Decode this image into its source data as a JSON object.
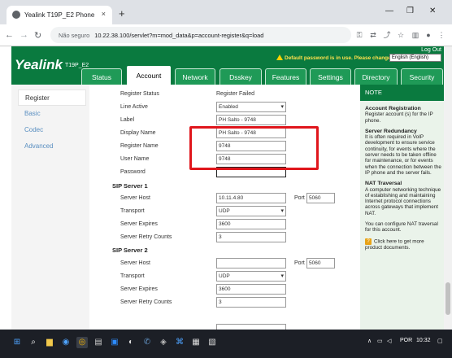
{
  "browser": {
    "tab_title": "Yealink T19P_E2 Phone",
    "new_tab": "+",
    "close_tab": "×",
    "security_label": "Não seguro",
    "url": "10.22.38.100/servlet?m=mod_data&p=account-register&q=load",
    "win_min": "—",
    "win_restore": "❐",
    "win_close": "✕"
  },
  "header": {
    "brand": "Yealink",
    "model": "T19P_E2",
    "logout": "Log Out",
    "warning": "Default password is in use. Please change!",
    "language": "English (English)"
  },
  "tabs": [
    "Status",
    "Account",
    "Network",
    "Dsskey",
    "Features",
    "Settings",
    "Directory",
    "Security"
  ],
  "active_tab": "Account",
  "left_nav": [
    "Register",
    "Basic",
    "Codec",
    "Advanced"
  ],
  "form": {
    "register_status": {
      "label": "Register Status",
      "value": "Register Failed"
    },
    "line_active": {
      "label": "Line Active",
      "value": "Enabled"
    },
    "label": {
      "label": "Label",
      "value": "PH Salto - 9748"
    },
    "display_name": {
      "label": "Display Name",
      "value": "PH Salto - 9748"
    },
    "register_name": {
      "label": "Register Name",
      "value": "9748"
    },
    "user_name": {
      "label": "User Name",
      "value": "9748"
    },
    "password": {
      "label": "Password",
      "value": ""
    },
    "sip1": {
      "title": "SIP Server 1",
      "host_label": "Server Host",
      "host": "10.11.4.80",
      "port_label": "Port",
      "port": "5060",
      "transport_label": "Transport",
      "transport": "UDP",
      "expires_label": "Server Expires",
      "expires": "3600",
      "retry_label": "Server Retry Counts",
      "retry": "3"
    },
    "sip2": {
      "title": "SIP Server 2",
      "host_label": "Server Host",
      "host": "",
      "port_label": "Port",
      "port": "5060",
      "transport_label": "Transport",
      "transport": "UDP",
      "expires_label": "Server Expires",
      "expires": "3600",
      "retry_label": "Server Retry Counts",
      "retry": "3"
    }
  },
  "note": {
    "title": "NOTE",
    "h1": "Account Registration",
    "t1": "Register account (s) for the IP phone.",
    "h2": "Server Redundancy",
    "t2": "It is often required in VoIP development to ensure service continuity, for events where the server needs to be taken offline for maintenance, or for events when the connection between the IP phone and the server fails.",
    "h3": "NAT Traversal",
    "t3": "A computer networking technique of establishing and maintaining Internet protocol connections across gateways that implement NAT.",
    "t4": "You can configure NAT traversal for this account.",
    "help_icon": "?",
    "t5": "Click here to get more product documents."
  },
  "taskbar": {
    "lang": "POR",
    "time": "10:32",
    "tray_arrow": "∧"
  },
  "colors": {
    "brand_green": "#0a7a3f",
    "tab_green": "#1f9a57",
    "highlight_red": "#e0161c"
  }
}
